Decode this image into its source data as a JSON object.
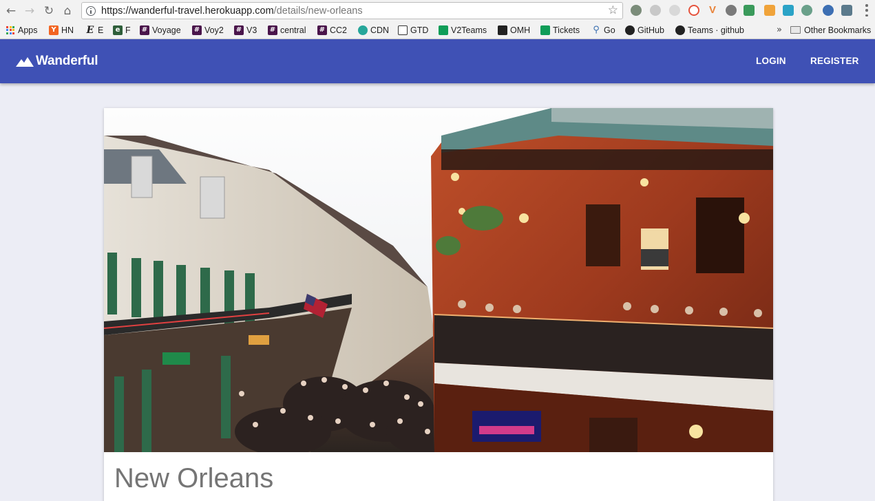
{
  "browser": {
    "url_host": "https://wanderful-travel.herokuapp.com",
    "url_path": "/details/new-orleans",
    "nav_icons": [
      "back-icon",
      "forward-icon",
      "reload-icon",
      "home-icon"
    ],
    "bookmarks": [
      {
        "label": "Apps",
        "icon": "apps-grid-icon"
      },
      {
        "label": "HN",
        "icon": "hacker-news-icon",
        "color": "#F26522"
      },
      {
        "label": "E",
        "icon": "e-icon"
      },
      {
        "label": "F",
        "icon": "f-icon",
        "color": "#2E7D32"
      },
      {
        "label": "Voyage",
        "icon": "slack-icon",
        "color": "#4A154B"
      },
      {
        "label": "Voy2",
        "icon": "slack-icon",
        "color": "#4A154B"
      },
      {
        "label": "V3",
        "icon": "slack-icon",
        "color": "#4A154B"
      },
      {
        "label": "central",
        "icon": "slack-icon",
        "color": "#4A154B"
      },
      {
        "label": "CC2",
        "icon": "slack-icon",
        "color": "#4A154B"
      },
      {
        "label": "CDN",
        "icon": "cdn-icon",
        "color": "#26A69A"
      },
      {
        "label": "GTD",
        "icon": "gtd-icon"
      },
      {
        "label": "V2Teams",
        "icon": "sheets-icon",
        "color": "#0F9D58"
      },
      {
        "label": "OMH",
        "icon": "omh-icon"
      },
      {
        "label": "Tickets",
        "icon": "sheets-icon",
        "color": "#0F9D58"
      },
      {
        "label": "Go",
        "icon": "link-icon"
      },
      {
        "label": "GitHub",
        "icon": "github-icon"
      },
      {
        "label": "Teams · github",
        "icon": "github-icon"
      }
    ],
    "overflow": "»",
    "other_bookmarks": "Other Bookmarks"
  },
  "app": {
    "brand": "Wanderful",
    "nav": {
      "login": "LOGIN",
      "register": "REGISTER"
    },
    "primary_color": "#3F51B5"
  },
  "destination": {
    "title": "New Orleans",
    "image_alt": "Bourbon Street, New Orleans"
  }
}
